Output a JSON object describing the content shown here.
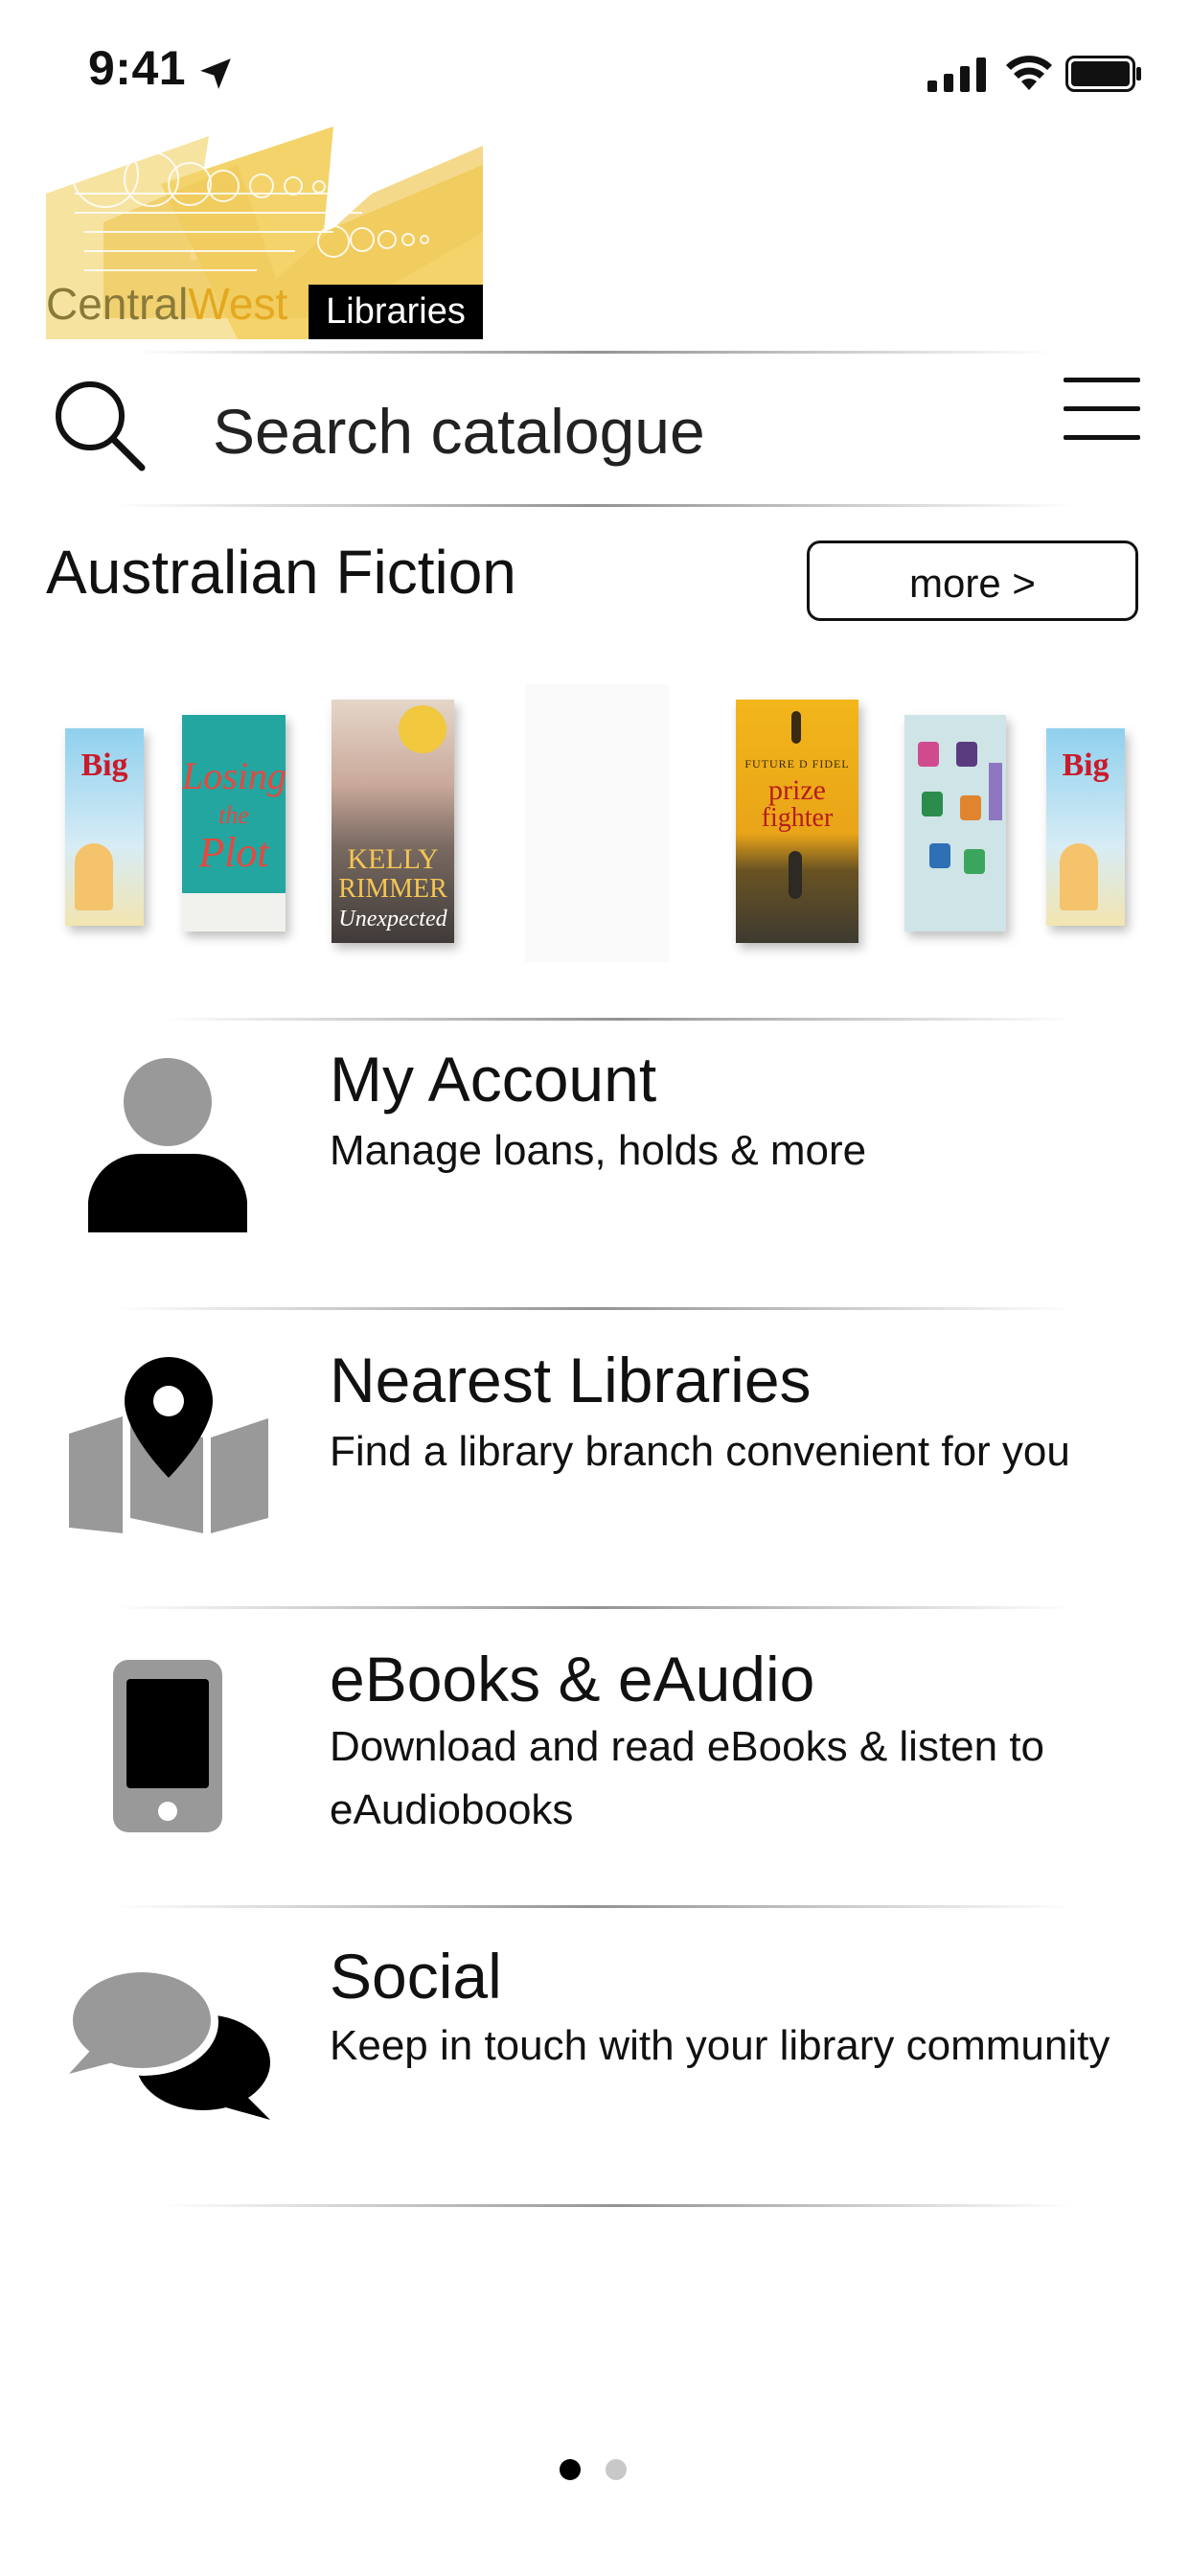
{
  "status": {
    "time": "9:41"
  },
  "logo": {
    "central": "Central",
    "west": "West",
    "libraries": "Libraries"
  },
  "search": {
    "placeholder": "Search catalogue"
  },
  "section": {
    "title": "Australian Fiction",
    "more_label": "more >",
    "books": [
      {
        "title": "Biggest Yesterday",
        "name": "book-cover-1"
      },
      {
        "title": "Losing the Plot",
        "name": "book-cover-2"
      },
      {
        "title": "KELLY RIMMER Unexpected",
        "name": "book-cover-3"
      },
      {
        "title": "",
        "name": "book-cover-4"
      },
      {
        "title": "prize fighter",
        "author": "FUTURE D FIDEL",
        "name": "book-cover-5"
      },
      {
        "title": "",
        "name": "book-cover-6"
      },
      {
        "title": "Biggest Yesterday",
        "name": "book-cover-7"
      }
    ]
  },
  "menu_items": [
    {
      "title": "My Account",
      "subtitle": "Manage loans, holds & more",
      "icon": "person-icon"
    },
    {
      "title": "Nearest Libraries",
      "subtitle": "Find a library branch convenient for you",
      "icon": "map-pin-icon"
    },
    {
      "title": "eBooks & eAudio",
      "subtitle": "Download and read eBooks & listen to eAudiobooks",
      "icon": "phone-icon"
    },
    {
      "title": "Social",
      "subtitle": "Keep in touch with your library community",
      "icon": "chat-bubbles-icon"
    }
  ],
  "pagination": {
    "pages": 2,
    "current": 1
  },
  "colors": {
    "logo_yellow": "#f3d36a",
    "logo_gold": "#e3a820",
    "icon_grey": "#999999"
  }
}
